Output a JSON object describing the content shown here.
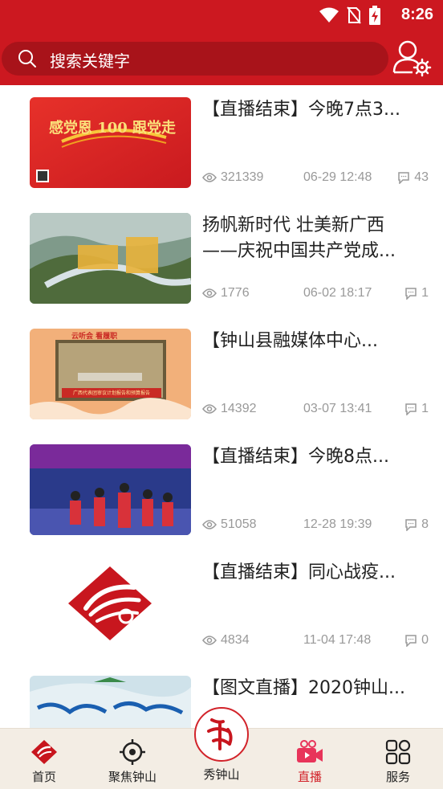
{
  "status_bar": {
    "time": "8:26"
  },
  "search": {
    "placeholder": "搜索关键字"
  },
  "feed": [
    {
      "title_lines": [
        "【直播结束】今晚7点3..."
      ],
      "views": "321339",
      "date": "06-29 12:48",
      "comments": "43"
    },
    {
      "title_lines": [
        "扬帆新时代 壮美新广西",
        "——庆祝中国共产党成..."
      ],
      "views": "1776",
      "date": "06-02 18:17",
      "comments": "1"
    },
    {
      "title_lines": [
        "【钟山县融媒体中心..."
      ],
      "views": "14392",
      "date": "03-07 13:41",
      "comments": "1"
    },
    {
      "title_lines": [
        "【直播结束】今晚8点..."
      ],
      "views": "51058",
      "date": "12-28 19:39",
      "comments": "8"
    },
    {
      "title_lines": [
        "【直播结束】同心战疫..."
      ],
      "views": "4834",
      "date": "11-04 17:48",
      "comments": "0"
    },
    {
      "title_lines": [
        "【图文直播】2020钟山..."
      ],
      "views": "",
      "date": "",
      "comments": ""
    }
  ],
  "thumb_text": {
    "t1_slogan": "感党恩 100 跟党走",
    "t3_banner": "广西代表团审议计划报告和预算报告",
    "t3_tag": "云听会 看履职"
  },
  "bottom_nav": {
    "home": "首页",
    "focus": "聚焦钟山",
    "center": "秀钟山",
    "live": "直播",
    "service": "服务"
  },
  "colors": {
    "brand_red": "#cc1820",
    "active_red": "#d2232a",
    "nav_bg": "#f3ede4"
  }
}
